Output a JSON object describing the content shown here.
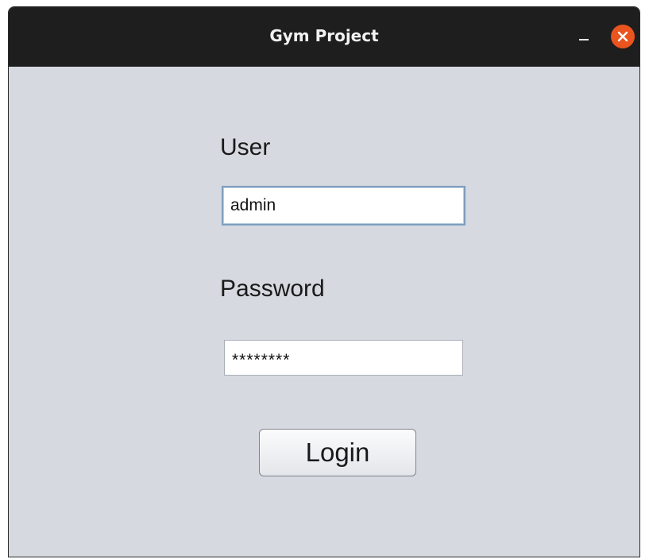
{
  "window": {
    "title": "Gym Project"
  },
  "form": {
    "user_label": "User",
    "user_value": "admin",
    "password_label": "Password",
    "password_value": "********",
    "login_label": "Login"
  },
  "colors": {
    "titlebar": "#1e1e1e",
    "close_button": "#e9541f",
    "window_background": "#d6d9e0"
  },
  "icons": {
    "minimize": "minimize-icon",
    "close": "close-icon"
  }
}
